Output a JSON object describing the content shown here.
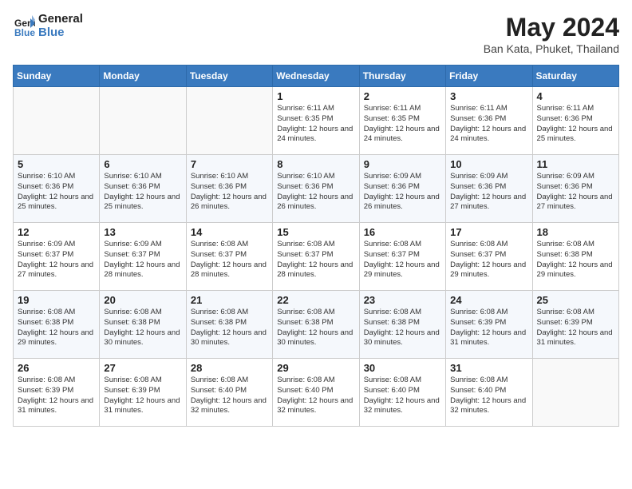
{
  "header": {
    "logo_line1": "General",
    "logo_line2": "Blue",
    "month_title": "May 2024",
    "location": "Ban Kata, Phuket, Thailand"
  },
  "days_of_week": [
    "Sunday",
    "Monday",
    "Tuesday",
    "Wednesday",
    "Thursday",
    "Friday",
    "Saturday"
  ],
  "weeks": [
    [
      {
        "day": "",
        "info": ""
      },
      {
        "day": "",
        "info": ""
      },
      {
        "day": "",
        "info": ""
      },
      {
        "day": "1",
        "info": "Sunrise: 6:11 AM\nSunset: 6:35 PM\nDaylight: 12 hours and 24 minutes."
      },
      {
        "day": "2",
        "info": "Sunrise: 6:11 AM\nSunset: 6:35 PM\nDaylight: 12 hours and 24 minutes."
      },
      {
        "day": "3",
        "info": "Sunrise: 6:11 AM\nSunset: 6:36 PM\nDaylight: 12 hours and 24 minutes."
      },
      {
        "day": "4",
        "info": "Sunrise: 6:11 AM\nSunset: 6:36 PM\nDaylight: 12 hours and 25 minutes."
      }
    ],
    [
      {
        "day": "5",
        "info": "Sunrise: 6:10 AM\nSunset: 6:36 PM\nDaylight: 12 hours and 25 minutes."
      },
      {
        "day": "6",
        "info": "Sunrise: 6:10 AM\nSunset: 6:36 PM\nDaylight: 12 hours and 25 minutes."
      },
      {
        "day": "7",
        "info": "Sunrise: 6:10 AM\nSunset: 6:36 PM\nDaylight: 12 hours and 26 minutes."
      },
      {
        "day": "8",
        "info": "Sunrise: 6:10 AM\nSunset: 6:36 PM\nDaylight: 12 hours and 26 minutes."
      },
      {
        "day": "9",
        "info": "Sunrise: 6:09 AM\nSunset: 6:36 PM\nDaylight: 12 hours and 26 minutes."
      },
      {
        "day": "10",
        "info": "Sunrise: 6:09 AM\nSunset: 6:36 PM\nDaylight: 12 hours and 27 minutes."
      },
      {
        "day": "11",
        "info": "Sunrise: 6:09 AM\nSunset: 6:36 PM\nDaylight: 12 hours and 27 minutes."
      }
    ],
    [
      {
        "day": "12",
        "info": "Sunrise: 6:09 AM\nSunset: 6:37 PM\nDaylight: 12 hours and 27 minutes."
      },
      {
        "day": "13",
        "info": "Sunrise: 6:09 AM\nSunset: 6:37 PM\nDaylight: 12 hours and 28 minutes."
      },
      {
        "day": "14",
        "info": "Sunrise: 6:08 AM\nSunset: 6:37 PM\nDaylight: 12 hours and 28 minutes."
      },
      {
        "day": "15",
        "info": "Sunrise: 6:08 AM\nSunset: 6:37 PM\nDaylight: 12 hours and 28 minutes."
      },
      {
        "day": "16",
        "info": "Sunrise: 6:08 AM\nSunset: 6:37 PM\nDaylight: 12 hours and 29 minutes."
      },
      {
        "day": "17",
        "info": "Sunrise: 6:08 AM\nSunset: 6:37 PM\nDaylight: 12 hours and 29 minutes."
      },
      {
        "day": "18",
        "info": "Sunrise: 6:08 AM\nSunset: 6:38 PM\nDaylight: 12 hours and 29 minutes."
      }
    ],
    [
      {
        "day": "19",
        "info": "Sunrise: 6:08 AM\nSunset: 6:38 PM\nDaylight: 12 hours and 29 minutes."
      },
      {
        "day": "20",
        "info": "Sunrise: 6:08 AM\nSunset: 6:38 PM\nDaylight: 12 hours and 30 minutes."
      },
      {
        "day": "21",
        "info": "Sunrise: 6:08 AM\nSunset: 6:38 PM\nDaylight: 12 hours and 30 minutes."
      },
      {
        "day": "22",
        "info": "Sunrise: 6:08 AM\nSunset: 6:38 PM\nDaylight: 12 hours and 30 minutes."
      },
      {
        "day": "23",
        "info": "Sunrise: 6:08 AM\nSunset: 6:38 PM\nDaylight: 12 hours and 30 minutes."
      },
      {
        "day": "24",
        "info": "Sunrise: 6:08 AM\nSunset: 6:39 PM\nDaylight: 12 hours and 31 minutes."
      },
      {
        "day": "25",
        "info": "Sunrise: 6:08 AM\nSunset: 6:39 PM\nDaylight: 12 hours and 31 minutes."
      }
    ],
    [
      {
        "day": "26",
        "info": "Sunrise: 6:08 AM\nSunset: 6:39 PM\nDaylight: 12 hours and 31 minutes."
      },
      {
        "day": "27",
        "info": "Sunrise: 6:08 AM\nSunset: 6:39 PM\nDaylight: 12 hours and 31 minutes."
      },
      {
        "day": "28",
        "info": "Sunrise: 6:08 AM\nSunset: 6:40 PM\nDaylight: 12 hours and 32 minutes."
      },
      {
        "day": "29",
        "info": "Sunrise: 6:08 AM\nSunset: 6:40 PM\nDaylight: 12 hours and 32 minutes."
      },
      {
        "day": "30",
        "info": "Sunrise: 6:08 AM\nSunset: 6:40 PM\nDaylight: 12 hours and 32 minutes."
      },
      {
        "day": "31",
        "info": "Sunrise: 6:08 AM\nSunset: 6:40 PM\nDaylight: 12 hours and 32 minutes."
      },
      {
        "day": "",
        "info": ""
      }
    ]
  ]
}
